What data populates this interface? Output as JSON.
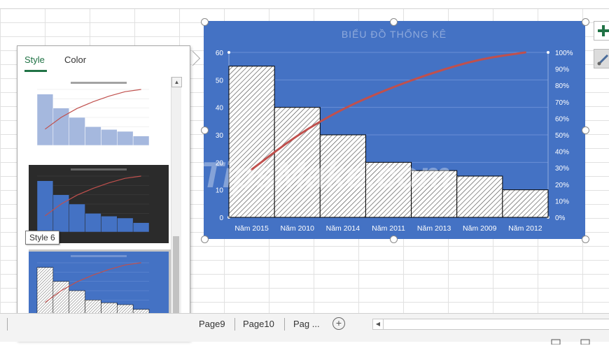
{
  "panel": {
    "tabs": [
      {
        "label": "Style",
        "active": true
      },
      {
        "label": "Color",
        "active": false
      }
    ],
    "tooltip": "Style 6"
  },
  "chart_data": {
    "type": "bar",
    "title": "BIỂU ĐỒ THỐNG KÊ",
    "categories": [
      "Năm 2015",
      "Năm 2010",
      "Năm 2014",
      "Năm 2011",
      "Năm 2013",
      "Năm 2009",
      "Năm 2012"
    ],
    "series": [
      {
        "values": [
          55,
          40,
          30,
          20,
          17,
          15,
          10
        ]
      },
      {
        "values": [
          29,
          50,
          66,
          78,
          88,
          96,
          100
        ]
      }
    ],
    "ylim": [
      0,
      60
    ],
    "yticks": [
      "0",
      "10",
      "20",
      "30",
      "40",
      "50",
      "60"
    ],
    "y2lim": [
      0,
      100
    ],
    "y2ticks": [
      "0%",
      "10%",
      "20%",
      "30%",
      "40%",
      "50%",
      "60%",
      "70%",
      "80%",
      "90%",
      "100%"
    ],
    "colors": {
      "background": "#4472c4",
      "bars": "#ffffff",
      "line": "#c0504d"
    },
    "grid": true,
    "legend": "none"
  },
  "sheets": {
    "tabs": [
      "Page9",
      "Page10",
      "Pag ..."
    ],
    "add_symbol": "+"
  },
  "watermark": "TipsMake.com"
}
